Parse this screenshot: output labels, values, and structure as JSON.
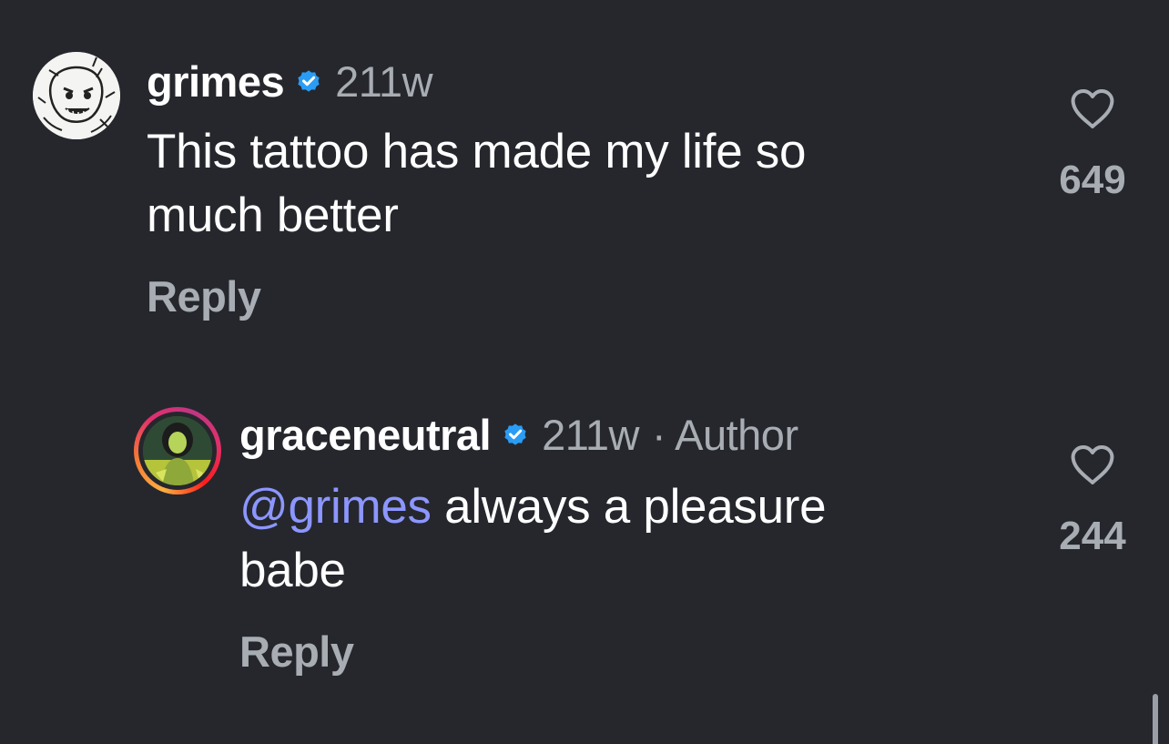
{
  "comments": [
    {
      "username": "grimes",
      "time": "211w",
      "text_lines": [
        "This tattoo has made my life so",
        "much better"
      ],
      "reply_label": "Reply",
      "likes": "649",
      "verified": true
    },
    {
      "username": "graceneutral",
      "time": "211w",
      "author_tag": "· Author",
      "mention": "@grimes",
      "text_after_mention": " always a pleasure",
      "text_line2": "babe",
      "reply_label": "Reply",
      "likes": "244",
      "verified": true
    }
  ],
  "colors": {
    "background": "#25272d",
    "text": "#ffffff",
    "muted": "#a8acb3",
    "mention": "#8c96ff",
    "verified": "#2a9cf5"
  },
  "icons": {
    "verified": "verified-badge-icon",
    "like": "heart-outline-icon"
  }
}
